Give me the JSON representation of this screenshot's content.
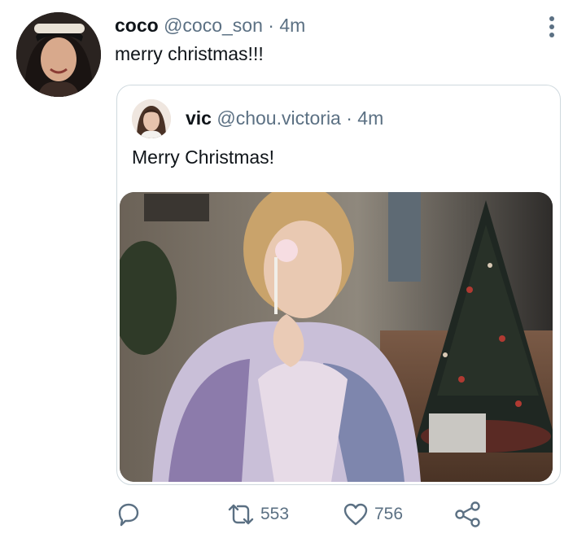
{
  "tweet": {
    "display_name": "coco",
    "handle": "@coco_son",
    "separator": "·",
    "time": "4m",
    "text": "merry christmas!!!",
    "avatar_icon": "profile-photo"
  },
  "quoted": {
    "display_name": "vic",
    "handle": "@chou.victoria",
    "separator": "·",
    "time": "4m",
    "text": "Merry Christmas!",
    "avatar_icon": "profile-photo",
    "media_icon": "photo"
  },
  "actions": {
    "reply_icon": "reply-icon",
    "retweet_count": "553",
    "like_count": "756",
    "share_icon": "share-icon"
  },
  "colors": {
    "muted": "#5b7083",
    "text": "#0f1419",
    "border": "#cfd9de"
  }
}
